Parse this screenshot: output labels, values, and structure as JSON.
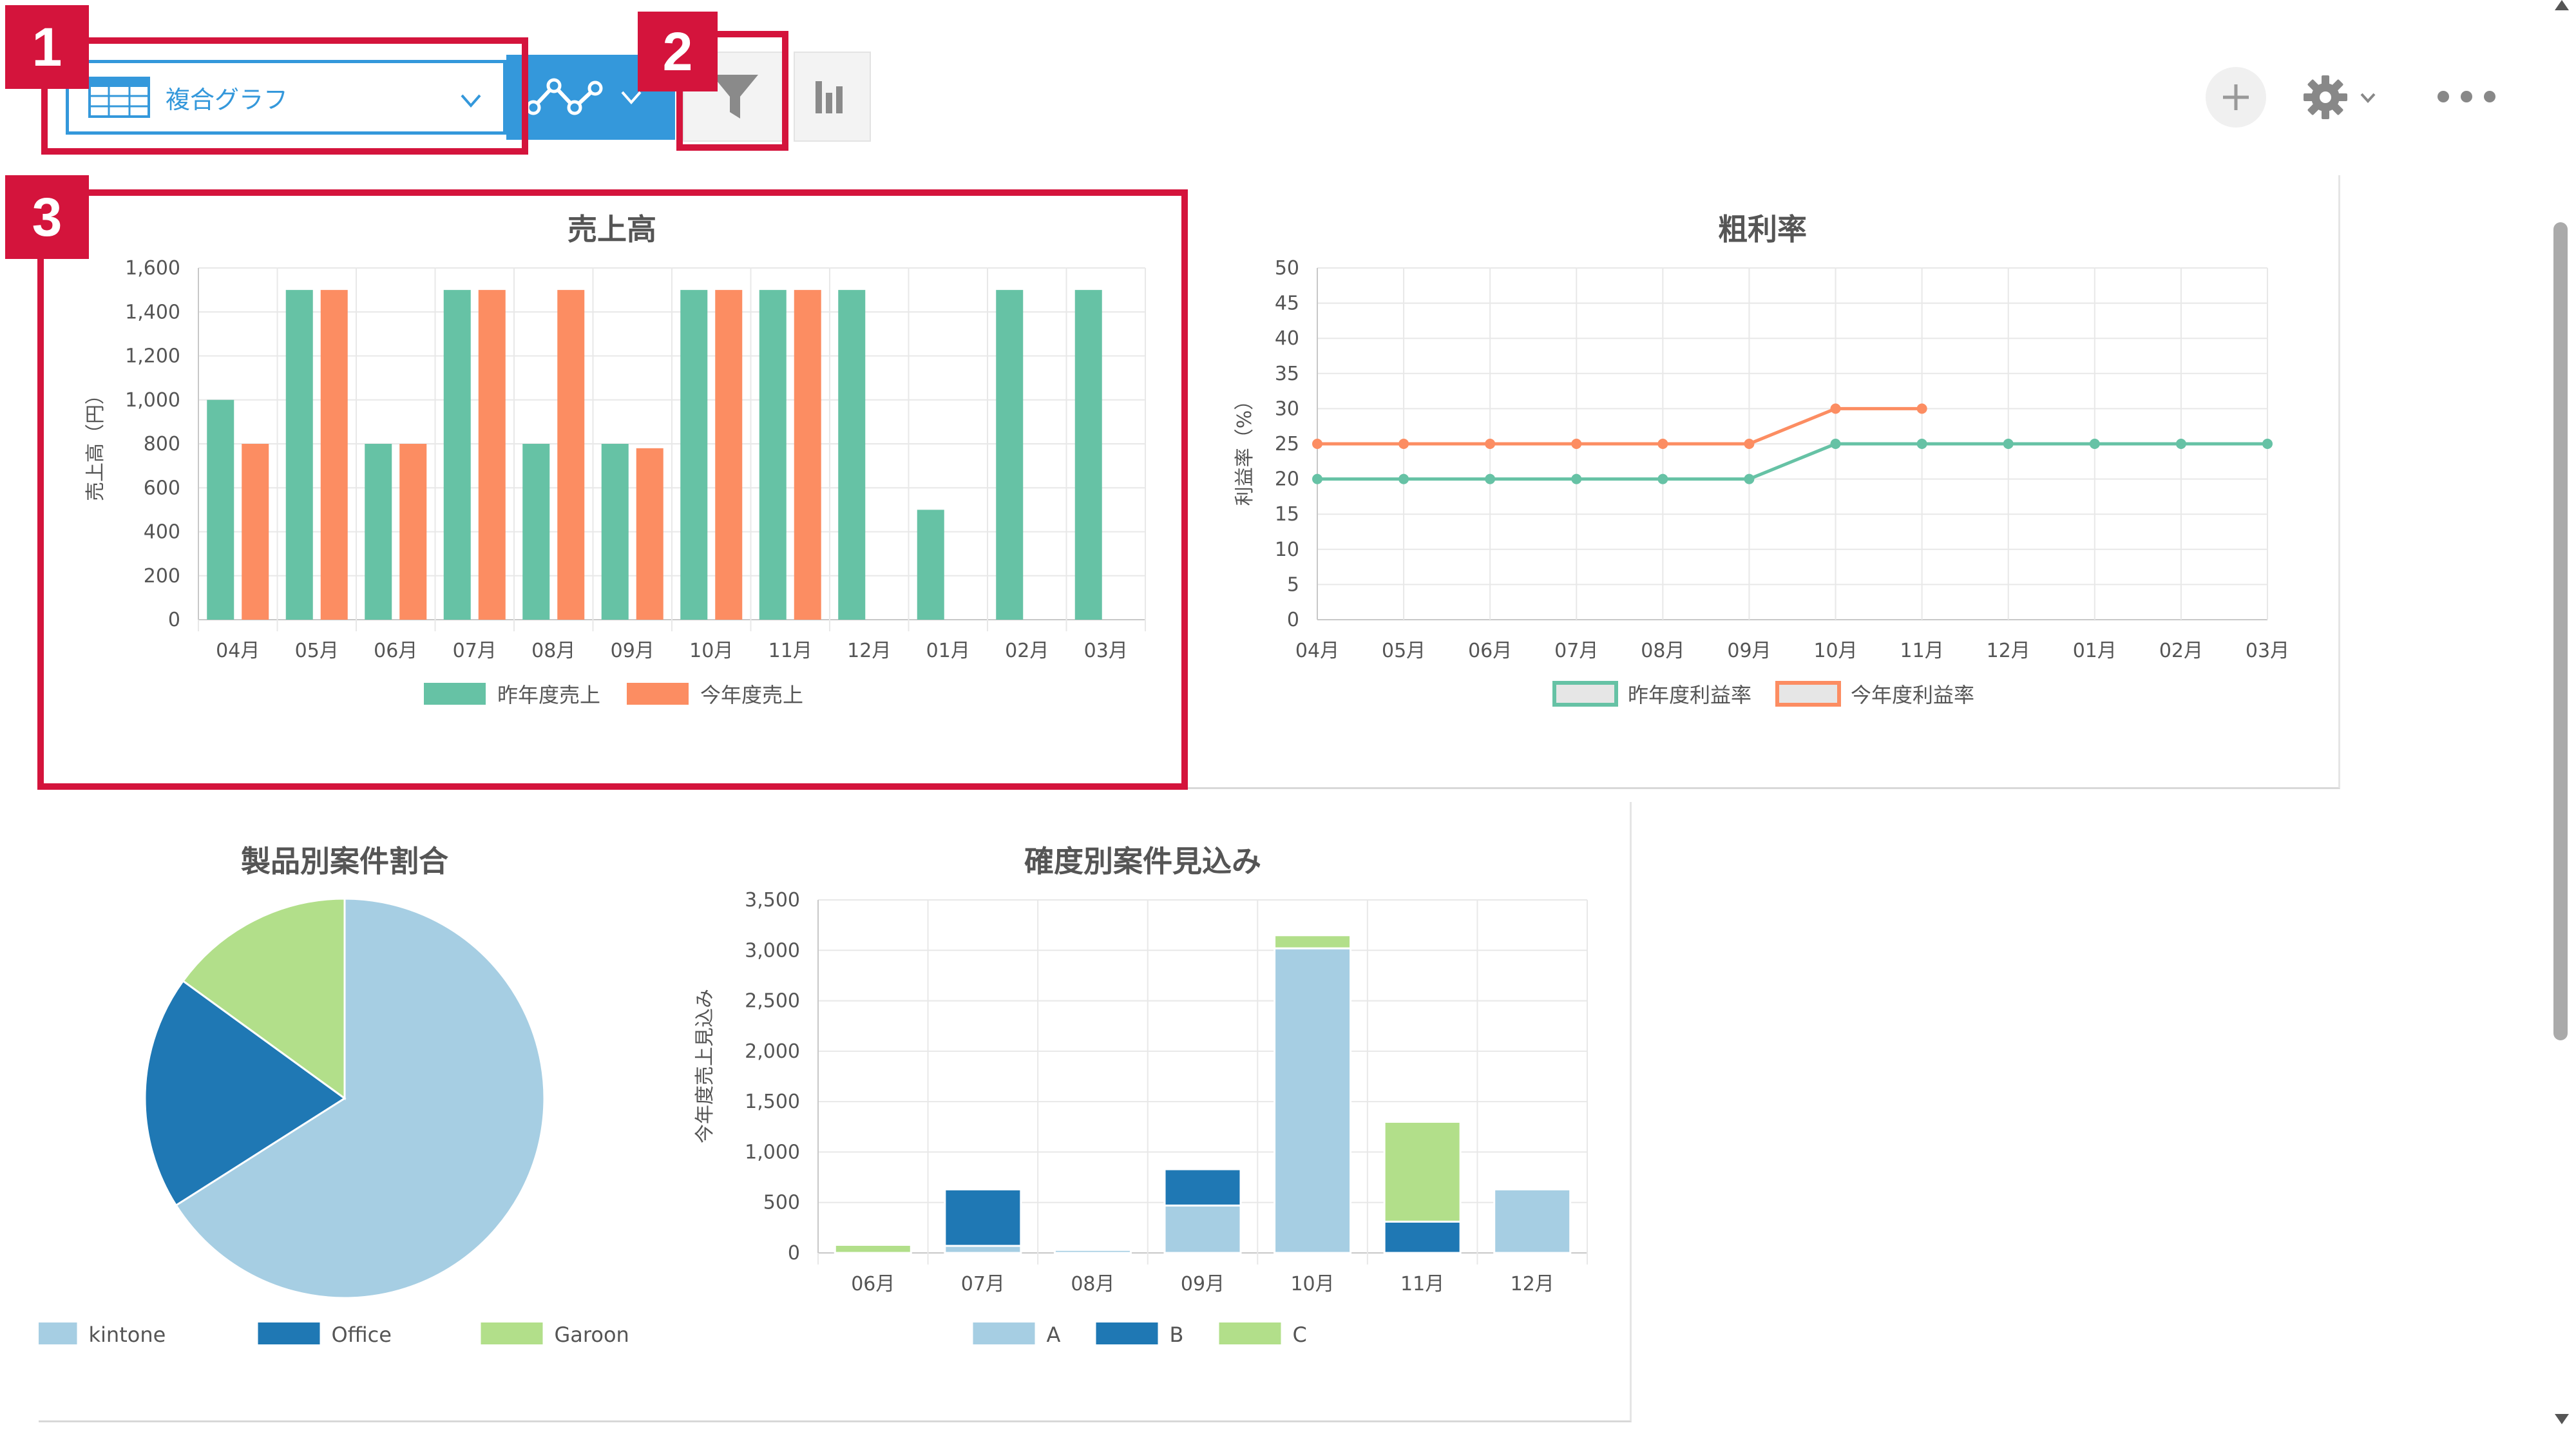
{
  "toolbar": {
    "view_select": {
      "label": "複合グラフ",
      "icon": "table-icon"
    },
    "chart_type_icon": "line-chart-icon",
    "filter_icon": "filter-icon",
    "graph_icon": "bar-chart-icon",
    "add_icon": "plus-icon",
    "settings_icon": "gear-icon",
    "more_icon": "more-icon"
  },
  "callouts": [
    "1",
    "2",
    "3"
  ],
  "colors": {
    "callout_red": "#d4143c",
    "accent_blue": "#3498db",
    "green": "#66c2a5",
    "orange": "#fc8d62",
    "light_blue": "#a6cee3",
    "dark_blue": "#1f78b4",
    "light_green": "#b2df8a"
  },
  "chart_data": [
    {
      "id": "sales",
      "type": "bar",
      "title": "売上高",
      "ylabel": "売上高（円）",
      "categories": [
        "04月",
        "05月",
        "06月",
        "07月",
        "08月",
        "09月",
        "10月",
        "11月",
        "12月",
        "01月",
        "02月",
        "03月"
      ],
      "yticks": [
        "0",
        "200",
        "400",
        "600",
        "800",
        "1,000",
        "1,200",
        "1,400",
        "1,600"
      ],
      "ylim": [
        0,
        1600
      ],
      "series": [
        {
          "name": "昨年度売上",
          "color": "#66c2a5",
          "values": [
            1000,
            1500,
            800,
            1500,
            800,
            800,
            1500,
            1500,
            1500,
            500,
            1500,
            1500
          ]
        },
        {
          "name": "今年度売上",
          "color": "#fc8d62",
          "values": [
            800,
            1500,
            800,
            1500,
            1500,
            780,
            1500,
            1500,
            null,
            null,
            null,
            null
          ]
        }
      ]
    },
    {
      "id": "margin",
      "type": "line",
      "title": "粗利率",
      "ylabel": "利益率（%）",
      "categories": [
        "04月",
        "05月",
        "06月",
        "07月",
        "08月",
        "09月",
        "10月",
        "11月",
        "12月",
        "01月",
        "02月",
        "03月"
      ],
      "yticks": [
        "0",
        "5",
        "10",
        "15",
        "20",
        "25",
        "30",
        "35",
        "40",
        "45",
        "50"
      ],
      "ylim": [
        0,
        50
      ],
      "series": [
        {
          "name": "昨年度利益率",
          "color": "#66c2a5",
          "values": [
            20,
            20,
            20,
            20,
            20,
            20,
            25,
            25,
            25,
            25,
            25,
            25
          ]
        },
        {
          "name": "今年度利益率",
          "color": "#fc8d62",
          "values": [
            25,
            25,
            25,
            25,
            25,
            25,
            30,
            30,
            null,
            null,
            null,
            null
          ]
        }
      ]
    },
    {
      "id": "product",
      "type": "pie",
      "title": "製品別案件割合",
      "slices": [
        {
          "name": "kintone",
          "value": 66,
          "color": "#a6cee3"
        },
        {
          "name": "Office",
          "value": 19,
          "color": "#1f78b4"
        },
        {
          "name": "Garoon",
          "value": 15,
          "color": "#b2df8a"
        }
      ]
    },
    {
      "id": "forecast",
      "type": "bar",
      "stacked": true,
      "title": "確度別案件見込み",
      "ylabel": "今年度売上見込み",
      "categories": [
        "06月",
        "07月",
        "08月",
        "09月",
        "10月",
        "11月",
        "12月"
      ],
      "yticks": [
        "0",
        "500",
        "1,000",
        "1,500",
        "2,000",
        "2,500",
        "3,000",
        "3,500"
      ],
      "ylim": [
        0,
        3500
      ],
      "series": [
        {
          "name": "A",
          "color": "#a6cee3",
          "values": [
            0,
            70,
            30,
            470,
            3020,
            0,
            630
          ]
        },
        {
          "name": "B",
          "color": "#1f78b4",
          "values": [
            0,
            560,
            0,
            360,
            0,
            310,
            0
          ]
        },
        {
          "name": "C",
          "color": "#b2df8a",
          "values": [
            80,
            0,
            0,
            0,
            130,
            990,
            0
          ]
        }
      ]
    }
  ]
}
